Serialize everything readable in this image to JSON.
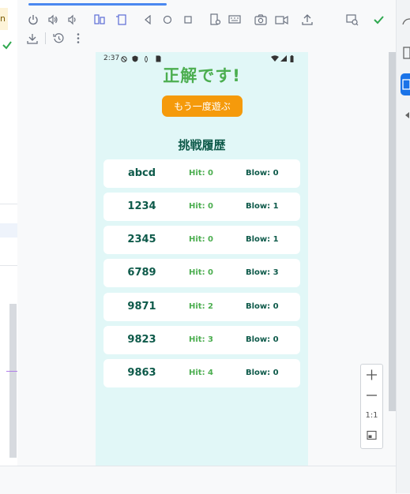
{
  "left_panel": {
    "badge_text": "n"
  },
  "status_bar": {
    "time": "2:37"
  },
  "app": {
    "result_title": "正解です!",
    "play_again_label": "もう一度遊ぶ",
    "history_title": "挑戦履歴",
    "history": [
      {
        "guess": "abcd",
        "hit": "Hit: 0",
        "blow": "Blow: 0"
      },
      {
        "guess": "1234",
        "hit": "Hit: 0",
        "blow": "Blow: 1"
      },
      {
        "guess": "2345",
        "hit": "Hit: 0",
        "blow": "Blow: 1"
      },
      {
        "guess": "6789",
        "hit": "Hit: 0",
        "blow": "Blow: 3"
      },
      {
        "guess": "9871",
        "hit": "Hit: 2",
        "blow": "Blow: 0"
      },
      {
        "guess": "9823",
        "hit": "Hit: 3",
        "blow": "Blow: 0"
      },
      {
        "guess": "9863",
        "hit": "Hit: 4",
        "blow": "Blow: 0"
      }
    ]
  },
  "zoom": {
    "one_to_one_label": "1:1"
  },
  "colors": {
    "success_green": "#4cae50",
    "accent_orange": "#f59a0b",
    "device_bg": "#e1f7f7",
    "text_teal": "#0e5a4a",
    "toolbar_blue": "#4a88f0"
  },
  "toolbar_icons": [
    "power-icon",
    "volume-up-icon",
    "volume-down-icon",
    "rotate-left-icon",
    "rotate-right-icon",
    "back-icon",
    "home-icon",
    "overview-icon",
    "device-settings-icon",
    "keyboard-icon",
    "camera-icon",
    "video-icon",
    "upload-icon",
    "mirror-icon",
    "check-icon",
    "download-icon",
    "history-icon",
    "more-icon"
  ]
}
